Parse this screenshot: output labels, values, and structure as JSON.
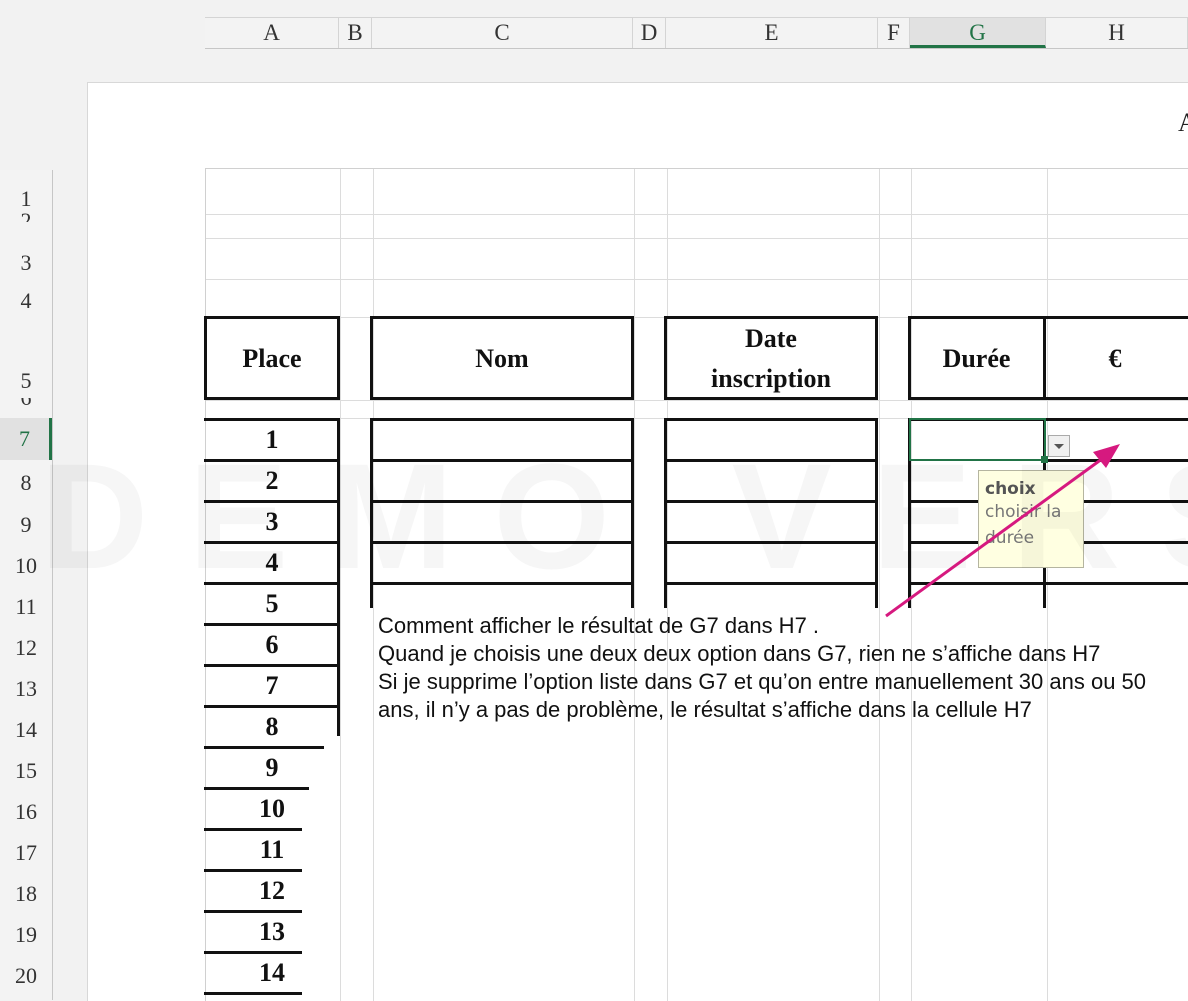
{
  "columns": [
    {
      "label": "A"
    },
    {
      "label": "B"
    },
    {
      "label": "C"
    },
    {
      "label": "D"
    },
    {
      "label": "E"
    },
    {
      "label": "F"
    },
    {
      "label": "G"
    },
    {
      "label": "H"
    }
  ],
  "rows": [
    "1",
    "2",
    "3",
    "4",
    "5",
    "6",
    "7",
    "8",
    "9",
    "10",
    "11",
    "12",
    "13",
    "14",
    "15",
    "16",
    "17",
    "18",
    "19",
    "20"
  ],
  "cut_header_letter": "A",
  "table_headers": {
    "place": "Place",
    "nom": "Nom",
    "date_line1": "Date",
    "date_line2": "inscription",
    "duree": "Durée",
    "euro": "€"
  },
  "place_numbers": [
    "1",
    "2",
    "3",
    "4",
    "5",
    "6",
    "7",
    "8",
    "9",
    "10",
    "11",
    "12",
    "13",
    "14"
  ],
  "tooltip": {
    "title": "choix",
    "body_line1": "choisir la",
    "body_line2": "durée"
  },
  "note": {
    "line1": "Comment afficher le résultat de G7 dans H7 .",
    "line2": "Quand je choisis une deux deux option dans G7, rien ne s’affiche dans H7",
    "line3": "Si je supprime l’option liste dans G7 et qu’on entre manuellement 30 ans ou 50 ans, il n’y a pas de problème, le résultat s’affiche dans la cellule H7"
  },
  "watermark": "DEMO VERSION",
  "accent_color": "#217346",
  "arrow_color": "#d6197f"
}
